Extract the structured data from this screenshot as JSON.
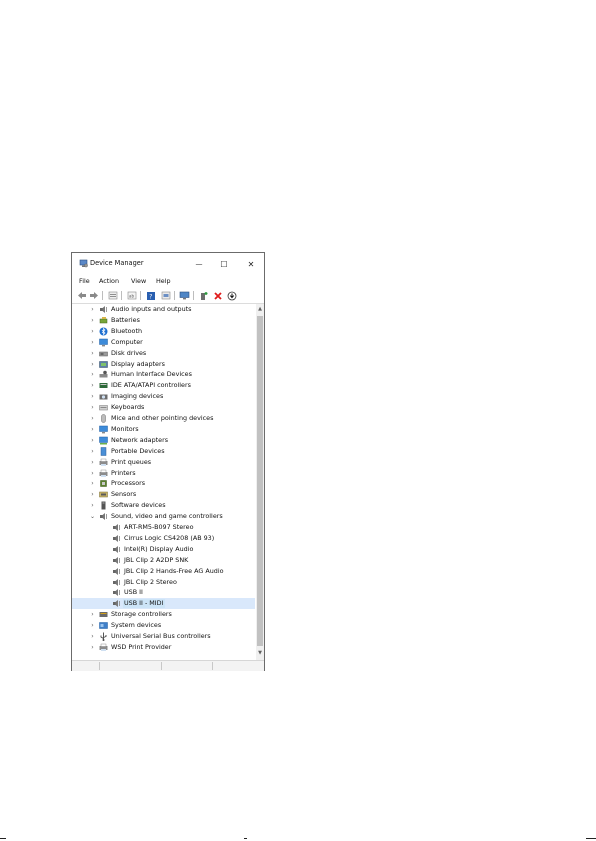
{
  "window": {
    "title": "Device Manager",
    "controls": {
      "minimize": "—",
      "maximize": "☐",
      "close": "✕"
    }
  },
  "menu": [
    "File",
    "Action",
    "View",
    "Help"
  ],
  "toolbar": [
    "back-icon",
    "forward-icon",
    "properties-icon",
    "resources-icon",
    "help-icon",
    "details-icon",
    "computer-icon",
    "add-driver-icon",
    "uninstall-icon",
    "update-icon"
  ],
  "tree": {
    "categories_before": [
      {
        "label": "Audio inputs and outputs",
        "icon": "speaker-icon"
      },
      {
        "label": "Batteries",
        "icon": "battery-icon"
      },
      {
        "label": "Bluetooth",
        "icon": "bluetooth-icon"
      },
      {
        "label": "Computer",
        "icon": "monitor-icon"
      },
      {
        "label": "Disk drives",
        "icon": "disk-icon"
      },
      {
        "label": "Display adapters",
        "icon": "display-icon"
      },
      {
        "label": "Human Interface Devices",
        "icon": "hid-icon"
      },
      {
        "label": "IDE ATA/ATAPI controllers",
        "icon": "ide-icon"
      },
      {
        "label": "Imaging devices",
        "icon": "camera-icon"
      },
      {
        "label": "Keyboards",
        "icon": "keyboard-icon"
      },
      {
        "label": "Mice and other pointing devices",
        "icon": "mouse-icon"
      },
      {
        "label": "Monitors",
        "icon": "monitor-icon"
      },
      {
        "label": "Network adapters",
        "icon": "network-icon"
      },
      {
        "label": "Portable Devices",
        "icon": "portable-icon"
      },
      {
        "label": "Print queues",
        "icon": "printer-icon"
      },
      {
        "label": "Printers",
        "icon": "printer-icon"
      },
      {
        "label": "Processors",
        "icon": "cpu-icon"
      },
      {
        "label": "Sensors",
        "icon": "sensor-icon"
      },
      {
        "label": "Software devices",
        "icon": "software-icon"
      }
    ],
    "expanded": {
      "label": "Sound, video and game controllers",
      "icon": "speaker-icon",
      "children": [
        {
          "label": "ART-RM5-B097 Stereo"
        },
        {
          "label": "Cirrus Logic CS4208 (AB 93)"
        },
        {
          "label": "Intel(R) Display Audio"
        },
        {
          "label": "JBL Clip 2 A2DP SNK"
        },
        {
          "label": "JBL Clip 2 Hands-Free AG Audio"
        },
        {
          "label": "JBL Clip 2 Stereo"
        },
        {
          "label": "USB II"
        },
        {
          "label": "USB II - MIDI",
          "selected": true
        }
      ]
    },
    "categories_after": [
      {
        "label": "Storage controllers",
        "icon": "storage-icon"
      },
      {
        "label": "System devices",
        "icon": "system-icon"
      },
      {
        "label": "Universal Serial Bus controllers",
        "icon": "usb-icon"
      },
      {
        "label": "WSD Print Provider",
        "icon": "printer-icon"
      }
    ]
  },
  "colors": {
    "selection": "#cce4f7",
    "accent": "#1e78d7",
    "uninstall": "#e01b1b",
    "add": "#2e9b3f"
  }
}
